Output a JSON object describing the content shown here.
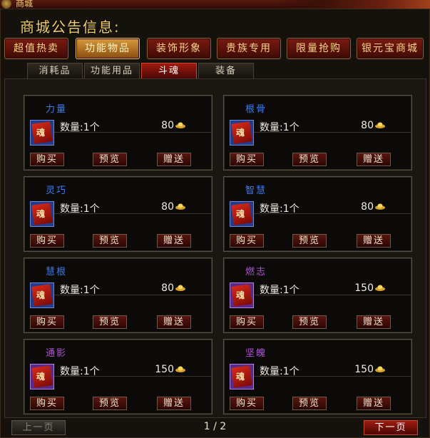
{
  "window": {
    "title": "商城"
  },
  "notice": {
    "title": "商城公告信息:"
  },
  "categories": [
    "超值热卖",
    "功能物品",
    "装饰形象",
    "贵族专用",
    "限量抢购",
    "银元宝商城"
  ],
  "subtabs": [
    "消耗品",
    "功能用品",
    "斗魂",
    "装备"
  ],
  "items": [
    {
      "name": "力量",
      "qty_label": "数量:1个",
      "price": "80",
      "buy": "购买",
      "preview": "预览",
      "gift": "赠送"
    },
    {
      "name": "根骨",
      "qty_label": "数量:1个",
      "price": "80",
      "buy": "购买",
      "preview": "预览",
      "gift": "赠送"
    },
    {
      "name": "灵巧",
      "qty_label": "数量:1个",
      "price": "80",
      "buy": "购买",
      "preview": "预览",
      "gift": "赠送"
    },
    {
      "name": "智慧",
      "qty_label": "数量:1个",
      "price": "80",
      "buy": "购买",
      "preview": "预览",
      "gift": "赠送"
    },
    {
      "name": "慧根",
      "qty_label": "数量:1个",
      "price": "80",
      "buy": "购买",
      "preview": "预览",
      "gift": "赠送"
    },
    {
      "name": "燃志",
      "qty_label": "数量:1个",
      "price": "150",
      "buy": "购买",
      "preview": "预览",
      "gift": "赠送"
    },
    {
      "name": "通影",
      "qty_label": "数量:1个",
      "price": "150",
      "buy": "购买",
      "preview": "预览",
      "gift": "赠送"
    },
    {
      "name": "坚魄",
      "qty_label": "数量:1个",
      "price": "150",
      "buy": "购买",
      "preview": "预览",
      "gift": "赠送"
    }
  ],
  "item_icon_glyph": "魂",
  "pagination": {
    "prev": "上一页",
    "next": "下一页",
    "page": "1 / 2"
  },
  "colors": {
    "name_blue": "#3d7cf0",
    "name_purple": "#b050d8",
    "gold": "#f0cf6a"
  }
}
